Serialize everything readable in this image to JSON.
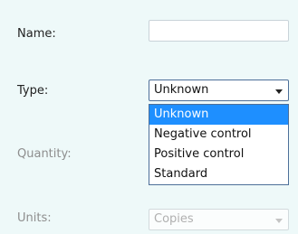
{
  "form": {
    "name_label": "Name:",
    "name_value": "",
    "type_label": "Type:",
    "type_selected": "Unknown",
    "type_options": [
      "Unknown",
      "Negative control",
      "Positive control",
      "Standard"
    ],
    "quantity_label": "Quantity:",
    "units_label": "Units:",
    "units_selected": "Copies"
  },
  "icons": {
    "dropdown": "chevron-down-icon"
  },
  "colors": {
    "panel_background": "#eef9f9",
    "selected_option_bg": "#1e8fff",
    "dropdown_border": "#4d6f99"
  }
}
